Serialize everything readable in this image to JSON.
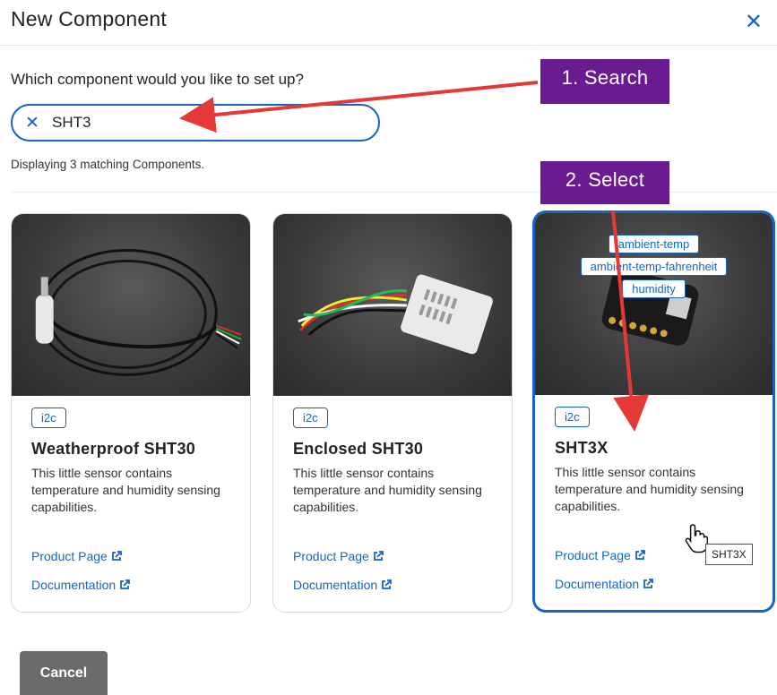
{
  "dialog": {
    "title": "New Component",
    "prompt": "Which component would you like to set up?",
    "search": {
      "value": "SHT3",
      "placeholder": ""
    },
    "match_text": "Displaying 3 matching Components.",
    "cancel_label": "Cancel"
  },
  "cards": [
    {
      "badge": "i2c",
      "name": "Weatherproof SHT30",
      "description": "This little sensor contains temperature and humidity sensing capabilities.",
      "product_link": "Product Page",
      "docs_link": "Documentation"
    },
    {
      "badge": "i2c",
      "name": "Enclosed SHT30",
      "description": "This little sensor contains temperature and humidity sensing capabilities.",
      "product_link": "Product Page",
      "docs_link": "Documentation"
    },
    {
      "badge": "i2c",
      "name": "SHT3X",
      "description": "This little sensor contains temperature and humidity sensing capabilities.",
      "product_link": "Product Page",
      "docs_link": "Documentation",
      "tags": [
        "ambient-temp",
        "ambient-temp-fahrenheit",
        "humidity"
      ],
      "selected": true
    }
  ],
  "annotations": {
    "step1": "1. Search",
    "step2": "2. Select"
  },
  "tooltip": "SHT3X",
  "colors": {
    "accent": "#1565c0",
    "annotation": "#6a1b8f",
    "arrow": "#e53935",
    "cancel": "#6b6b6b"
  }
}
